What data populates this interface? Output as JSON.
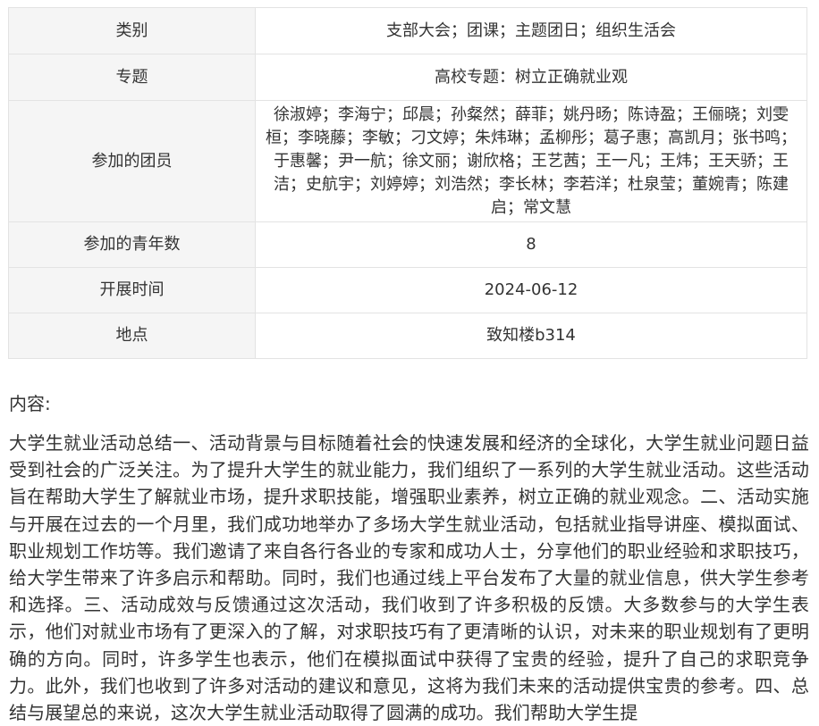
{
  "table": {
    "rows": [
      {
        "label": "类别",
        "value": "支部大会；团课；主题团日；组织生活会"
      },
      {
        "label": "专题",
        "value": "高校专题：树立正确就业观"
      },
      {
        "label": "参加的团员",
        "value": "徐淑婷；李海宁；邱晨；孙粲然；薛菲；姚丹旸；陈诗盈；王俪晓；刘雯桓；李晓藤；李敏；刁文婷；朱炜琳；孟柳彤；葛子惠；高凯月；张书鸣；于惠馨；尹一航；徐文丽；谢欣格；王艺茜；王一凡；王炜；王天骄；王洁；史航宇；刘婷婷；刘浩然；李长林；李若洋；杜泉莹；董婉青；陈建启；常文慧"
      },
      {
        "label": "参加的青年数",
        "value": "8"
      },
      {
        "label": "开展时间",
        "value": "2024-06-12"
      },
      {
        "label": "地点",
        "value": "致知楼b314"
      }
    ]
  },
  "content": {
    "title": "内容:",
    "body": "大学生就业活动总结一、活动背景与目标随着社会的快速发展和经济的全球化，大学生就业问题日益受到社会的广泛关注。为了提升大学生的就业能力，我们组织了一系列的大学生就业活动。这些活动旨在帮助大学生了解就业市场，提升求职技能，增强职业素养，树立正确的就业观念。二、活动实施与开展在过去的一个月里，我们成功地举办了多场大学生就业活动，包括就业指导讲座、模拟面试、职业规划工作坊等。我们邀请了来自各行各业的专家和成功人士，分享他们的职业经验和求职技巧，给大学生带来了许多启示和帮助。同时，我们也通过线上平台发布了大量的就业信息，供大学生参考和选择。三、活动成效与反馈通过这次活动，我们收到了许多积极的反馈。大多数参与的大学生表示，他们对就业市场有了更深入的了解，对求职技巧有了更清晰的认识，对未来的职业规划有了更明确的方向。同时，许多学生也表示，他们在模拟面试中获得了宝贵的经验，提升了自己的求职竞争力。此外，我们也收到了许多对活动的建议和意见，这将为我们未来的活动提供宝贵的参考。四、总结与展望总的来说，这次大学生就业活动取得了圆满的成功。我们帮助大学生提"
  }
}
